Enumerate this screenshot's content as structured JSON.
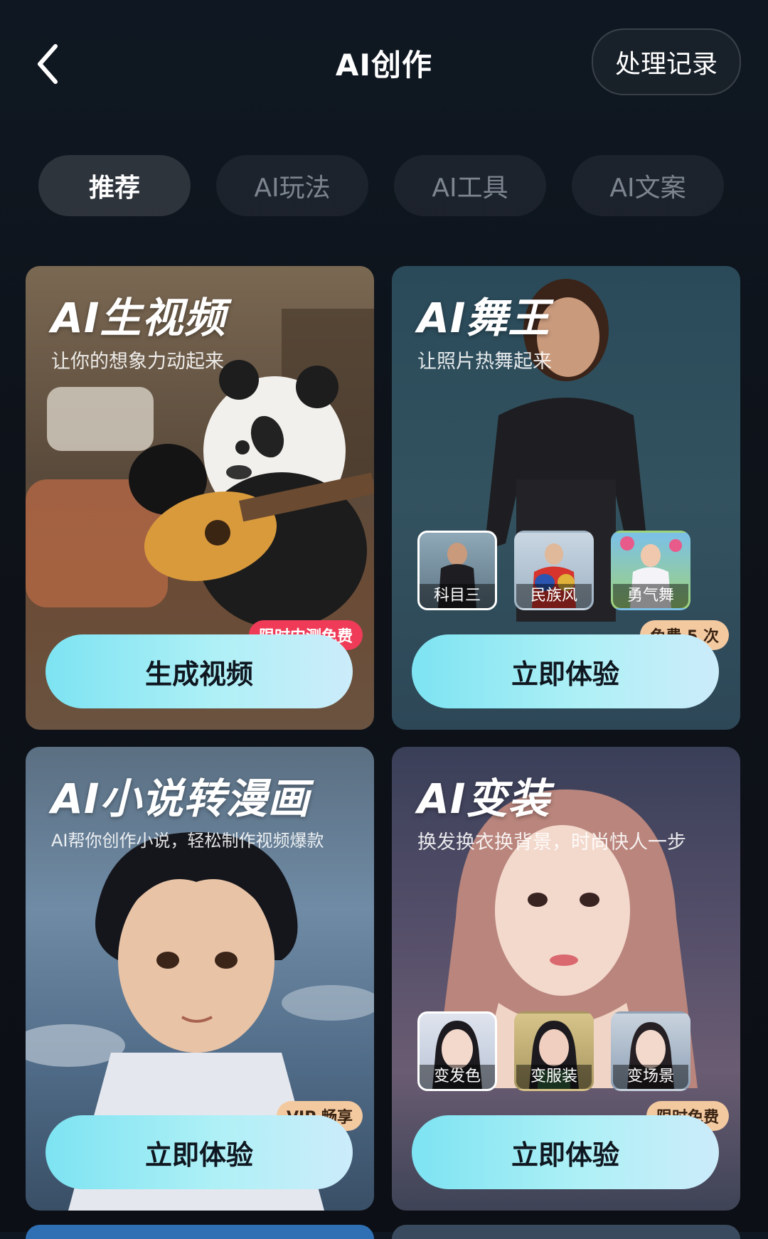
{
  "header": {
    "title": "AI创作",
    "history_label": "处理记录"
  },
  "tabs": [
    {
      "label": "推荐",
      "active": true
    },
    {
      "label": "AI玩法",
      "active": false
    },
    {
      "label": "AI工具",
      "active": false
    },
    {
      "label": "AI文案",
      "active": false
    }
  ],
  "cards": [
    {
      "title": "AI生视频",
      "subtitle": "让你的想象力动起来",
      "badge": "限时内测免费",
      "cta": "生成视频"
    },
    {
      "title": "AI舞王",
      "subtitle": "让照片热舞起来",
      "badge": "免费 5 次",
      "cta": "立即体验",
      "options": [
        "科目三",
        "民族风",
        "勇气舞"
      ]
    },
    {
      "title": "AI小说转漫画",
      "subtitle": "AI帮你创作小说，轻松制作视频爆款",
      "badge": "VIP 畅享",
      "cta": "立即体验"
    },
    {
      "title": "AI变装",
      "subtitle": "换发换衣换背景，时尚快人一步",
      "badge": "限时免费",
      "cta": "立即体验",
      "options": [
        "变发色",
        "变服装",
        "变场景"
      ]
    }
  ]
}
